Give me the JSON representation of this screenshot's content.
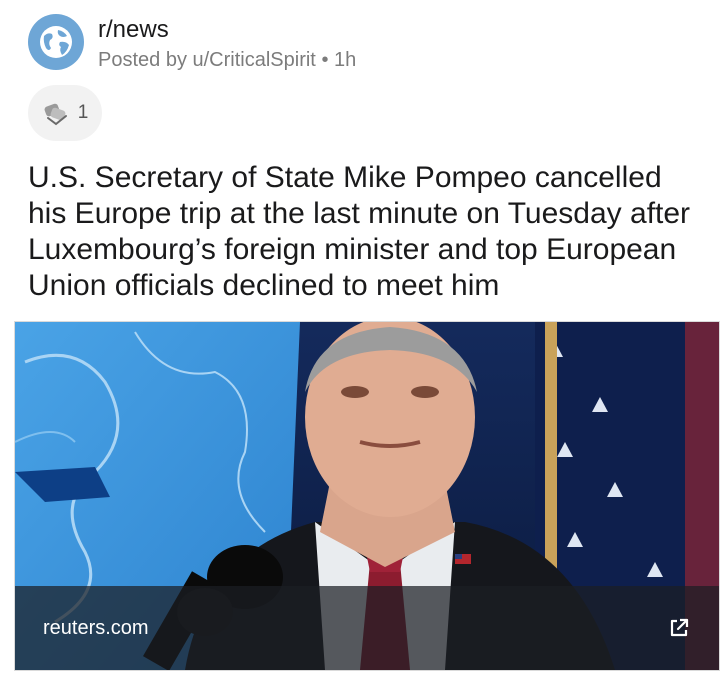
{
  "post": {
    "subreddit": "r/news",
    "posted_by": "Posted by u/CriticalSpirit",
    "separator": "•",
    "age": "1h",
    "award_count": "1",
    "title": "U.S. Secretary of State Mike Pompeo cancelled his Europe trip at the last minute on Tuesday after Luxembourg’s foreign minister and top European Union officials declined to meet him"
  },
  "link": {
    "domain": "reuters.com"
  },
  "icons": {
    "subreddit": "globe-icon",
    "award": "award-icon",
    "external": "external-link-icon"
  },
  "colors": {
    "avatar_bg": "#6ea6d6",
    "meta_text": "#7c7c7c",
    "award_bg": "#f2f2f2"
  }
}
